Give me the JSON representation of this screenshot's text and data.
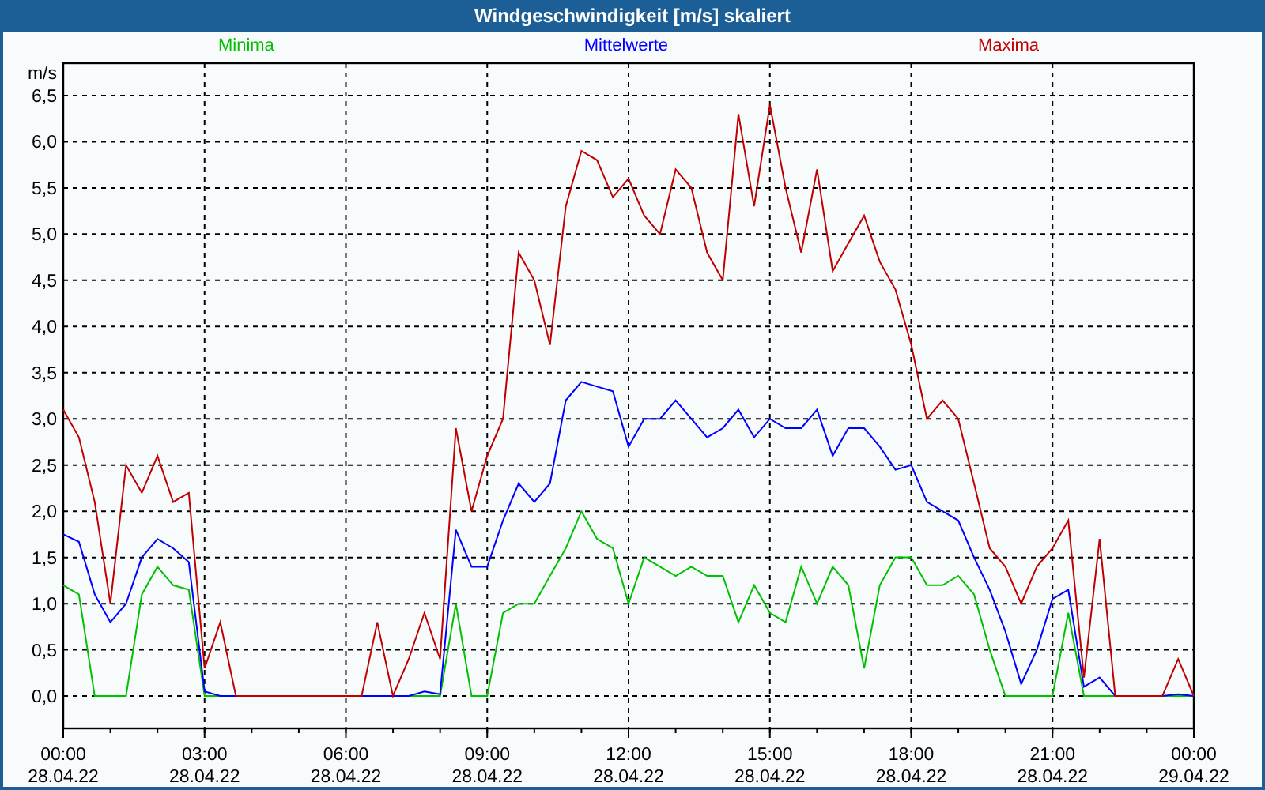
{
  "window": {
    "title": "Windgeschwindigkeit [m/s] skaliert"
  },
  "chart": {
    "chart_data": {
      "type": "line",
      "grid": true,
      "ylabel": "m/s",
      "ylim": [
        -0.35,
        6.85
      ],
      "categories": [
        "00:00 28.04.22",
        null,
        null,
        null,
        null,
        null,
        null,
        null,
        null,
        "03:00 28.04.22",
        null,
        null,
        null,
        null,
        null,
        null,
        null,
        null,
        "06:00 28.04.22",
        null,
        null,
        null,
        null,
        null,
        null,
        null,
        null,
        "09:00 28.04.22",
        null,
        null,
        null,
        null,
        null,
        null,
        null,
        null,
        "12:00 28.04.22",
        null,
        null,
        null,
        null,
        null,
        null,
        null,
        null,
        "15:00 28.04.22",
        null,
        null,
        null,
        null,
        null,
        null,
        null,
        null,
        "18:00 28.04.22",
        null,
        null,
        null,
        null,
        null,
        null,
        null,
        null,
        "21:00 28.04.22",
        null,
        null,
        null,
        null,
        null,
        null,
        null,
        null,
        "00:00 29.04.22"
      ],
      "yticks": [
        {
          "value": 0,
          "label": "0,0"
        },
        {
          "value": 0.5,
          "label": "0,5"
        },
        {
          "value": 1,
          "label": "1,0"
        },
        {
          "value": 1.5,
          "label": "1,5"
        },
        {
          "value": 2,
          "label": "2,0"
        },
        {
          "value": 2.5,
          "label": "2,5"
        },
        {
          "value": 3,
          "label": "3,0"
        },
        {
          "value": 3.5,
          "label": "3,5"
        },
        {
          "value": 4,
          "label": "4,0"
        },
        {
          "value": 4.5,
          "label": "4,5"
        },
        {
          "value": 5,
          "label": "5,0"
        },
        {
          "value": 5.5,
          "label": "5,5"
        },
        {
          "value": 6,
          "label": "6,0"
        },
        {
          "value": 6.5,
          "label": "6,5"
        }
      ],
      "series": [
        {
          "name": "Minima",
          "color": "#00c000",
          "values": [
            1.2,
            1.1,
            0,
            0,
            0,
            1.1,
            1.4,
            1.2,
            1.15,
            0,
            0,
            0,
            0,
            0,
            0,
            0,
            0,
            0,
            0,
            0,
            0,
            0,
            0,
            0,
            0,
            1.0,
            0,
            0,
            0.9,
            1.0,
            1.0,
            1.3,
            1.6,
            2.0,
            1.7,
            1.6,
            1.0,
            1.5,
            1.4,
            1.3,
            1.4,
            1.3,
            1.3,
            0.8,
            1.2,
            0.9,
            0.8,
            1.4,
            1.0,
            1.4,
            1.2,
            0.3,
            1.2,
            1.5,
            1.5,
            1.2,
            1.2,
            1.3,
            1.1,
            0.5,
            0,
            0,
            0,
            0,
            0.9,
            0,
            0,
            0,
            0,
            0,
            0,
            0,
            0
          ]
        },
        {
          "name": "Mittelwerte",
          "color": "#0000ff",
          "values": [
            1.75,
            1.67,
            1.1,
            0.8,
            1.0,
            1.5,
            1.7,
            1.6,
            1.45,
            0.05,
            0,
            0,
            0,
            0,
            0,
            0,
            0,
            0,
            0,
            0,
            0,
            0,
            0,
            0.05,
            0.02,
            1.8,
            1.4,
            1.4,
            1.9,
            2.3,
            2.1,
            2.3,
            3.2,
            3.4,
            3.35,
            3.3,
            2.7,
            3.0,
            3.0,
            3.2,
            3.0,
            2.8,
            2.9,
            3.1,
            2.8,
            3.0,
            2.9,
            2.9,
            3.1,
            2.6,
            2.9,
            2.9,
            2.7,
            2.45,
            2.5,
            2.1,
            2.0,
            1.9,
            1.5,
            1.15,
            0.7,
            0.13,
            0.5,
            1.05,
            1.15,
            0.1,
            0.2,
            0,
            0,
            0,
            0,
            0.02,
            0
          ]
        },
        {
          "name": "Maxima",
          "color": "#c00000",
          "values": [
            3.1,
            2.8,
            2.1,
            1.0,
            2.5,
            2.2,
            2.6,
            2.1,
            2.2,
            0.3,
            0.8,
            0,
            0,
            0,
            0,
            0,
            0,
            0,
            0,
            0,
            0.8,
            0,
            0.4,
            0.9,
            0.4,
            2.9,
            2.0,
            2.6,
            3.0,
            4.8,
            4.5,
            3.8,
            5.3,
            5.9,
            5.8,
            5.4,
            5.6,
            5.2,
            5.0,
            5.7,
            5.5,
            4.8,
            4.5,
            6.3,
            5.3,
            6.4,
            5.5,
            4.8,
            5.7,
            4.6,
            4.9,
            5.2,
            4.7,
            4.4,
            3.8,
            3.0,
            3.2,
            3.0,
            2.3,
            1.6,
            1.4,
            1.0,
            1.4,
            1.6,
            1.9,
            0.2,
            1.7,
            0,
            0,
            0,
            0,
            0.4,
            0
          ]
        }
      ]
    }
  }
}
